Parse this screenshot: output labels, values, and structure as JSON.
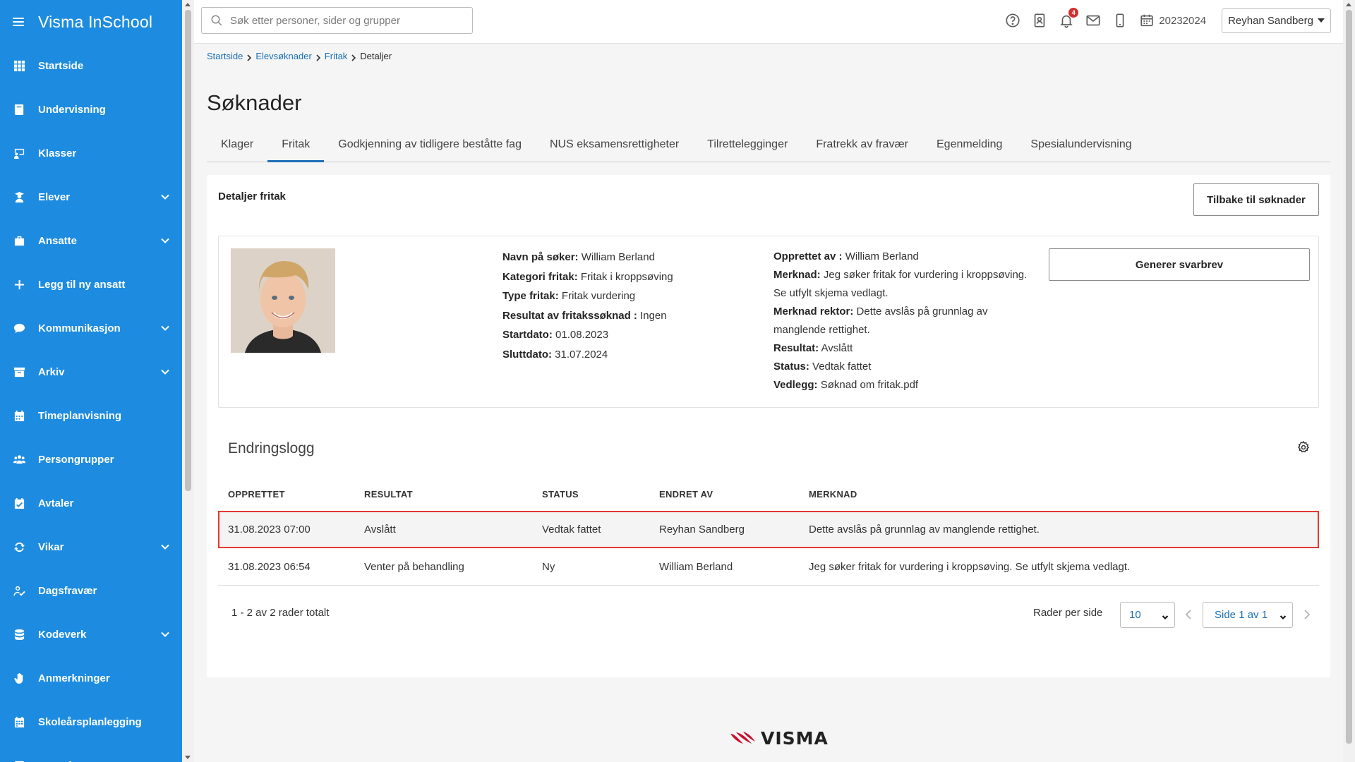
{
  "app": {
    "title": "Visma InSchool"
  },
  "sidebar": {
    "items": [
      {
        "label": "Startside",
        "icon": "grid-icon",
        "expandable": false
      },
      {
        "label": "Undervisning",
        "icon": "book-icon",
        "expandable": false
      },
      {
        "label": "Klasser",
        "icon": "classroom-icon",
        "expandable": false
      },
      {
        "label": "Elever",
        "icon": "student-icon",
        "expandable": true
      },
      {
        "label": "Ansatte",
        "icon": "briefcase-icon",
        "expandable": true
      },
      {
        "label": "Legg til ny ansatt",
        "icon": "plus-icon",
        "expandable": false
      },
      {
        "label": "Kommunikasjon",
        "icon": "chat-icon",
        "expandable": true
      },
      {
        "label": "Arkiv",
        "icon": "archive-icon",
        "expandable": true
      },
      {
        "label": "Timeplanvisning",
        "icon": "calendar-icon",
        "expandable": false
      },
      {
        "label": "Persongrupper",
        "icon": "people-icon",
        "expandable": false
      },
      {
        "label": "Avtaler",
        "icon": "calendar-check-icon",
        "expandable": false
      },
      {
        "label": "Vikar",
        "icon": "sync-icon",
        "expandable": true
      },
      {
        "label": "Dagsfravær",
        "icon": "user-check-icon",
        "expandable": false
      },
      {
        "label": "Kodeverk",
        "icon": "database-icon",
        "expandable": true
      },
      {
        "label": "Anmerkninger",
        "icon": "hand-icon",
        "expandable": false
      },
      {
        "label": "Skoleårsplanlegging",
        "icon": "calendar-grid-icon",
        "expandable": false
      },
      {
        "label": "Fagvalg",
        "icon": "checkbox-icon",
        "expandable": true
      }
    ]
  },
  "topbar": {
    "search_placeholder": "Søk etter personer, sider og grupper",
    "notification_count": "4",
    "school_year": "20232024",
    "user_name": "Reyhan Sandberg"
  },
  "breadcrumb": {
    "items": [
      "Startside",
      "Elevsøknader",
      "Fritak"
    ],
    "current": "Detaljer"
  },
  "page": {
    "title": "Søknader",
    "tabs": [
      {
        "label": "Klager",
        "active": false
      },
      {
        "label": "Fritak",
        "active": true
      },
      {
        "label": "Godkjenning av tidligere beståtte fag",
        "active": false
      },
      {
        "label": "NUS eksamensrettigheter",
        "active": false
      },
      {
        "label": "Tilrettelegginger",
        "active": false
      },
      {
        "label": "Fratrekk av fravær",
        "active": false
      },
      {
        "label": "Egenmelding",
        "active": false
      },
      {
        "label": "Spesialundervisning",
        "active": false
      }
    ]
  },
  "details": {
    "heading": "Detaljer fritak",
    "back_button": "Tilbake til søknader",
    "generate_button": "Generer svarbrev",
    "col1": [
      {
        "label": "Navn på søker:",
        "value": "William Berland"
      },
      {
        "label": "Kategori fritak:",
        "value": "Fritak i kroppsøving"
      },
      {
        "label": "Type fritak:",
        "value": "Fritak vurdering"
      },
      {
        "label": "Resultat av fritakssøknad :",
        "value": "Ingen"
      },
      {
        "label": "Startdato:",
        "value": "01.08.2023"
      },
      {
        "label": "Sluttdato:",
        "value": "31.07.2024"
      }
    ],
    "col2": [
      {
        "label": "Opprettet av :",
        "value": "William Berland"
      },
      {
        "label": "Merknad:",
        "value": "Jeg søker fritak for vurdering i kroppsøving. Se utfylt skjema vedlagt."
      },
      {
        "label": "Merknad rektor:",
        "value": "Dette avslås på grunnlag av manglende rettighet."
      },
      {
        "label": "Resultat:",
        "value": "Avslått"
      },
      {
        "label": "Status:",
        "value": "Vedtak fattet"
      },
      {
        "label": "Vedlegg:",
        "value": "Søknad om fritak.pdf"
      }
    ]
  },
  "changelog": {
    "title": "Endringslogg",
    "columns": [
      "OPPRETTET",
      "RESULTAT",
      "STATUS",
      "ENDRET AV",
      "MERKNAD"
    ],
    "rows": [
      {
        "created": "31.08.2023 07:00",
        "result": "Avslått",
        "status": "Vedtak fattet",
        "changed_by": "Reyhan Sandberg",
        "note": "Dette avslås på grunnlag av manglende rettighet.",
        "highlighted": true
      },
      {
        "created": "31.08.2023 06:54",
        "result": "Venter på behandling",
        "status": "Ny",
        "changed_by": "William Berland",
        "note": "Jeg søker fritak for vurdering i kroppsøving. Se utfylt skjema vedlagt.",
        "highlighted": false
      }
    ],
    "total_text": "1 - 2 av 2 rader totalt",
    "rows_per_page_label": "Rader per side",
    "rows_per_page_value": "10",
    "page_value": "Side 1 av 1"
  },
  "footer": {
    "logo_text": "VISMA"
  },
  "colors": {
    "sidebar": "#1d8ce0",
    "accent": "#1d6fb8",
    "highlight_border": "#e53935",
    "badge": "#d32f2f"
  }
}
